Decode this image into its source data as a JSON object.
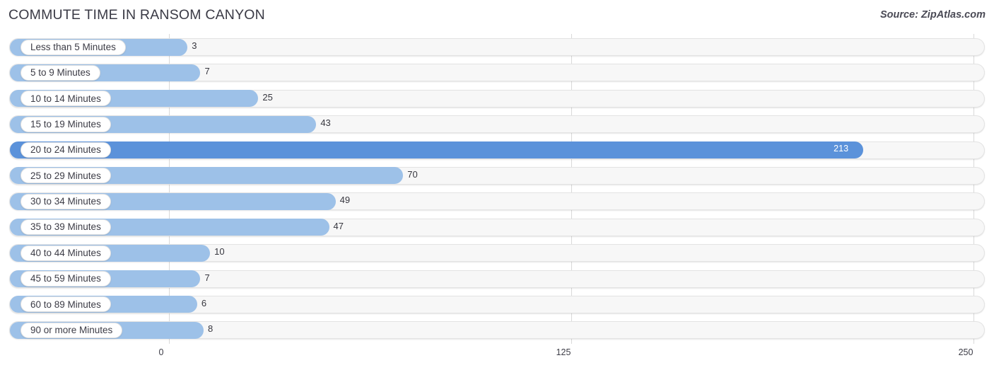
{
  "header": {
    "title": "COMMUTE TIME IN RANSOM CANYON",
    "source": "Source: ZipAtlas.com"
  },
  "axis": {
    "ticks": [
      "0",
      "125",
      "250"
    ]
  },
  "chart_data": {
    "type": "bar",
    "orientation": "horizontal",
    "title": "COMMUTE TIME IN RANSOM CANYON",
    "subtitle": "Source: ZipAtlas.com",
    "xlabel": "",
    "ylabel": "",
    "xlim": [
      0,
      250
    ],
    "xticks": [
      0,
      125,
      250
    ],
    "grid": true,
    "legend": "none",
    "highlight_category": "20 to 24 Minutes",
    "categories": [
      "Less than 5 Minutes",
      "5 to 9 Minutes",
      "10 to 14 Minutes",
      "15 to 19 Minutes",
      "20 to 24 Minutes",
      "25 to 29 Minutes",
      "30 to 34 Minutes",
      "35 to 39 Minutes",
      "40 to 44 Minutes",
      "45 to 59 Minutes",
      "60 to 89 Minutes",
      "90 or more Minutes"
    ],
    "values": [
      3,
      7,
      25,
      43,
      213,
      70,
      49,
      47,
      10,
      7,
      6,
      8
    ],
    "value_labels": [
      "3",
      "7",
      "25",
      "43",
      "213",
      "70",
      "49",
      "47",
      "10",
      "7",
      "6",
      "8"
    ],
    "colors": {
      "bar": "#9dc1e8",
      "bar_highlight": "#5b92da",
      "track": "#f7f7f7",
      "gridline": "#d9d9d9",
      "text": "#3c3c46"
    }
  }
}
